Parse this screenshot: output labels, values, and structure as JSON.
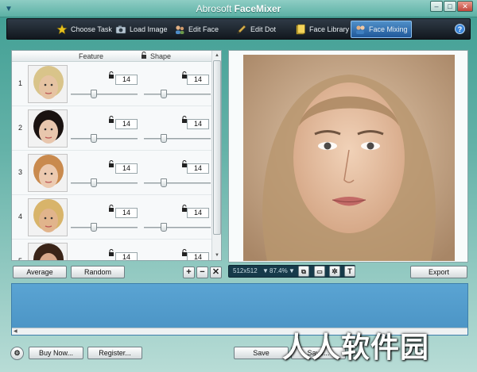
{
  "window": {
    "title_prefix": "Abrosoft ",
    "title_app": "FaceMixer",
    "min_label": "–",
    "max_label": "□",
    "close_label": "✕",
    "sys_menu": "▼"
  },
  "toolbar": {
    "items": [
      {
        "label": "Choose Task",
        "icon": "star-icon",
        "color": "#e8c21e"
      },
      {
        "label": "Load Image",
        "icon": "camera-icon",
        "color": "#9ab0c0"
      },
      {
        "label": "Edit Face",
        "icon": "people-icon",
        "color": "#d9a36a"
      },
      {
        "label": "Edit Dot",
        "icon": "pen-icon",
        "color": "#c9a24a"
      },
      {
        "label": "Face Library",
        "icon": "book-icon",
        "color": "#e7c43a"
      },
      {
        "label": "Face Mixing",
        "icon": "people-mix-icon",
        "color": "#cfd9e8"
      }
    ],
    "help_label": "?"
  },
  "list": {
    "header": {
      "feature": "Feature",
      "shape": "Shape"
    },
    "rows": [
      {
        "num": "1",
        "feature_value": "14",
        "shape_value": "14",
        "feature_level": 0.08,
        "shape_level": 0.08,
        "skin": "#e6c3a2",
        "hair": "#d9c48a"
      },
      {
        "num": "2",
        "feature_value": "14",
        "shape_value": "14",
        "feature_level": 0.08,
        "shape_level": 0.08,
        "skin": "#e8c6ad",
        "hair": "#1a1210"
      },
      {
        "num": "3",
        "feature_value": "14",
        "shape_value": "14",
        "feature_level": 0.08,
        "shape_level": 0.08,
        "skin": "#eccab0",
        "hair": "#c98a4e"
      },
      {
        "num": "4",
        "feature_value": "14",
        "shape_value": "14",
        "feature_level": 0.08,
        "shape_level": 0.08,
        "skin": "#e1b48c",
        "hair": "#d8b46a"
      },
      {
        "num": "5",
        "feature_value": "14",
        "shape_value": "14",
        "feature_level": 0.08,
        "shape_level": 0.08,
        "skin": "#d8a98c",
        "hair": "#3a2418"
      }
    ]
  },
  "left_buttons": {
    "average": "Average",
    "random": "Random",
    "add": "+",
    "remove": "−",
    "clear": "✕"
  },
  "preview": {
    "size_label": "512x512",
    "zoom_label": "87.4%",
    "export_label": "Export"
  },
  "bottom": {
    "buy_label": "Buy Now...",
    "register_label": "Register...",
    "save_label": "Save",
    "save_as_label": "Save..."
  },
  "watermark": "人人软件园"
}
